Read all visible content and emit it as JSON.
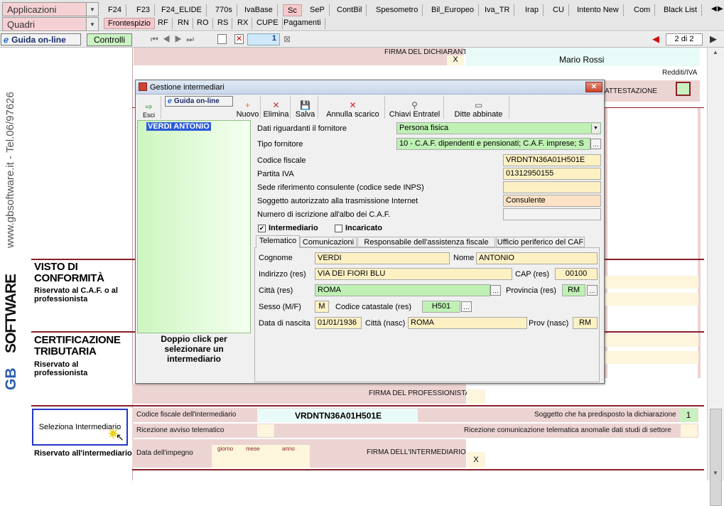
{
  "topbar": {
    "applicazioni": "Applicazioni",
    "quadri": "Quadri",
    "main_tabs": [
      "F24",
      "F23",
      "F24_ELIDE",
      "770s",
      "IvaBase",
      "Sc",
      "SeP",
      "ContBil",
      "Spesometro",
      "Bil_Europeo",
      "Iva_TR",
      "Irap",
      "CU",
      "Intento New",
      "Com",
      "Black List"
    ],
    "sub_tabs": [
      "Frontespizio",
      "RF",
      "RN",
      "RO",
      "RS",
      "RX",
      "CUPE",
      "Pagamenti"
    ]
  },
  "navbar": {
    "guida": "Guida on-line",
    "controlli": "Controlli",
    "page_num": "1",
    "page_of": "2 di 2"
  },
  "brand": {
    "phone": "www.gbsoftware.it - Tel.06/97626",
    "name": "SOFTWARE",
    "prefix": "GB"
  },
  "form": {
    "firma_dichiarante": "FIRMA DEL DICHIARANTE",
    "x1": "X",
    "signer_name": "Mario Rossi",
    "redditi_iva": "Redditi/IVA",
    "attestazione": "ATTESTAZIONE",
    "visto_title": "VISTO DI CONFORMITÀ",
    "visto_sub": "Riservato al C.A.F. o al professionista",
    "cert_title": "CERTIFICAZIONE TRIBUTARIA",
    "cert_sub": "Riservato al professionista",
    "firma_prof": "FIRMA DEL PROFESSIONISTA",
    "seleziona": "Seleziona Intermediario",
    "riservato_int": "Riservato all'intermediario",
    "cf_int_label": "Codice fiscale dell'intermediario",
    "cf_int_value": "VRDNTN36A01H501E",
    "soggetto_pred": "Soggetto che ha predisposto la dichiarazione",
    "soggetto_val": "1",
    "ricezione_avviso": "Ricezione avviso telematico",
    "ricezione_com": "Ricezione comunicazione telematica anomalie dati studi di settore",
    "data_impegno": "Data dell'impegno",
    "giorno": "giorno",
    "mese": "mese",
    "anno": "anno",
    "firma_int": "FIRMA DELL'INTERMEDIARIO",
    "x2": "X"
  },
  "dialog": {
    "title": "Gestione intermediari",
    "esci": "Esci",
    "guida": "Guida on-line",
    "toolbar": [
      "Nuovo",
      "Elimina",
      "Salva",
      "Annulla scarico",
      "Chiavi Entratel",
      "Ditte abbinate"
    ],
    "list": [
      "VERDI ANTONIO"
    ],
    "list_hint": "Doppio click per selezionare un intermediario",
    "fornitore_label": "Dati riguardanti il fornitore",
    "fornitore_value": "Persona fisica",
    "tipo_label": "Tipo fornitore",
    "tipo_value": "10 - C.A.F. dipendenti e pensionati; C.A.F. imprese; S",
    "cf_label": "Codice fiscale",
    "cf_value": "VRDNTN36A01H501E",
    "piva_label": "Partita IVA",
    "piva_value": "01312950155",
    "sede_label": "Sede riferimento consulente (codice sede INPS)",
    "sede_value": "",
    "sogg_label": "Soggetto autorizzato alla trasmissione Internet",
    "sogg_value": "Consulente",
    "albo_label": "Numero di iscrizione all'albo dei C.A.F.",
    "albo_value": "",
    "intermediario": "Intermediario",
    "incaricato": "Incaricato",
    "tabs": [
      "Telematico",
      "Comunicazioni",
      "Responsabile dell'assistenza fiscale",
      "Ufficio periferico del CAF"
    ],
    "cognome_label": "Cognome",
    "cognome": "VERDI",
    "nome_label": "Nome",
    "nome": "ANTONIO",
    "indirizzo_label": "Indirizzo (res)",
    "indirizzo": "VIA DEI FIORI BLU",
    "cap_label": "CAP (res)",
    "cap": "00100",
    "citta_label": "Città (res)",
    "citta": "ROMA",
    "prov_label": "Provincia (res)",
    "prov": "RM",
    "sesso_label": "Sesso (M/F)",
    "sesso": "M",
    "catastale_label": "Codice catastale (res)",
    "catastale": "H501",
    "nascita_label": "Data di nascita",
    "nascita": "01/01/1936",
    "citta_nasc_label": "Città (nasc)",
    "citta_nasc": "ROMA",
    "prov_nasc_label": "Prov (nasc)",
    "prov_nasc": "RM"
  },
  "colors": {
    "accent": "#8b1f2a",
    "pink": "#ecd4d3",
    "green": "#bff0b4",
    "yellow": "#fdf1c4"
  }
}
